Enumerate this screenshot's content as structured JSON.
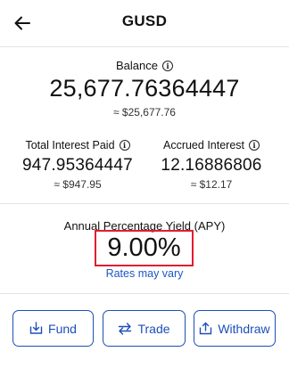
{
  "header": {
    "title": "GUSD"
  },
  "balance": {
    "label": "Balance",
    "value": "25,677.76364447",
    "usd": "≈ $25,677.76"
  },
  "total_interest": {
    "label": "Total Interest Paid",
    "value": "947.95364447",
    "usd": "≈ $947.95"
  },
  "accrued_interest": {
    "label": "Accrued Interest",
    "value": "12.16886806",
    "usd": "≈ $12.17"
  },
  "apy": {
    "label": "Annual Percentage Yield (APY)",
    "value": "9.00%",
    "note": "Rates may vary",
    "highlight_color": "#e11d2e"
  },
  "actions": {
    "fund": "Fund",
    "trade": "Trade",
    "withdraw": "Withdraw",
    "color": "#1c4fb8"
  },
  "icons": {
    "back": "arrow-left-icon",
    "info": "info-icon",
    "fund": "download-tray-icon",
    "trade": "swap-arrows-icon",
    "withdraw": "upload-tray-icon"
  }
}
